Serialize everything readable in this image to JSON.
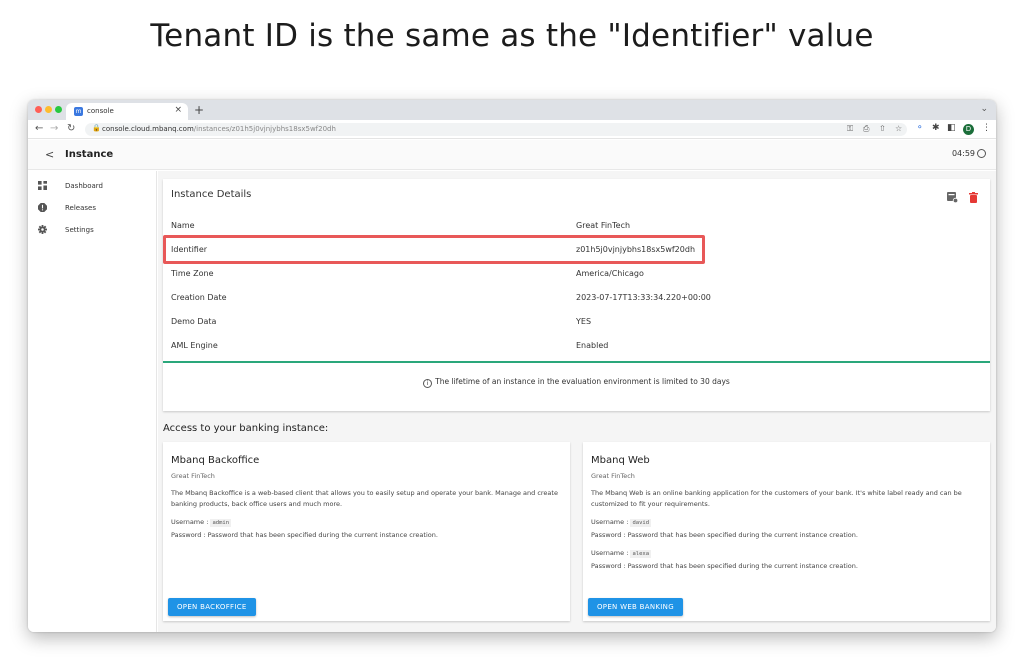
{
  "heading": "Tenant ID is the same as the \"Identifier\" value",
  "browser": {
    "tab_title": "console",
    "tab_close": "×",
    "new_tab": "+",
    "url_host": "console.cloud.mbanq.com",
    "url_path": "/instances/z01h5j0vjnjybhs18sx5wf20dh",
    "profile_initial": "D"
  },
  "app": {
    "back": "<",
    "page_title": "Instance",
    "clock": "04:59"
  },
  "sidebar": {
    "items": [
      {
        "label": "Dashboard",
        "icon": "dashboard-icon"
      },
      {
        "label": "Releases",
        "icon": "releases-icon"
      },
      {
        "label": "Settings",
        "icon": "settings-icon"
      }
    ]
  },
  "details": {
    "title": "Instance Details",
    "rows": [
      {
        "key": "Name",
        "value": "Great FinTech"
      },
      {
        "key": "Identifier",
        "value": "z01h5j0vjnjybhs18sx5wf20dh"
      },
      {
        "key": "Time Zone",
        "value": "America/Chicago"
      },
      {
        "key": "Creation Date",
        "value": "2023-07-17T13:33:34.220+00:00"
      },
      {
        "key": "Demo Data",
        "value": "YES"
      },
      {
        "key": "AML Engine",
        "value": "Enabled"
      }
    ],
    "notice": "The lifetime of an instance in the evaluation environment is limited to 30 days",
    "accent_color": "#2aa77b",
    "highlight_color": "#e85858"
  },
  "access": {
    "heading": "Access to your banking instance:",
    "backoffice": {
      "title": "Mbanq Backoffice",
      "subtitle": "Great FinTech",
      "description": "The Mbanq Backoffice is a web-based client that allows you to easily setup and operate your bank. Manage and create banking products, back office users and much more.",
      "username_label": "Username :",
      "username": "admin",
      "password_line": "Password : Password that has been specified during the current instance creation.",
      "button": "OPEN BACKOFFICE"
    },
    "web": {
      "title": "Mbanq Web",
      "subtitle": "Great FinTech",
      "description": "The Mbanq Web is an online banking application for the customers of your bank. It's white label ready and can be customized to fit your requirements.",
      "username_label_1": "Username :",
      "username_1": "david",
      "password_line_1": "Password : Password that has been specified during the current instance creation.",
      "username_label_2": "Username :",
      "username_2": "alexa",
      "password_line_2": "Password : Password that has been specified during the current instance creation.",
      "button": "OPEN WEB BANKING"
    },
    "button_color": "#1f93e6"
  }
}
